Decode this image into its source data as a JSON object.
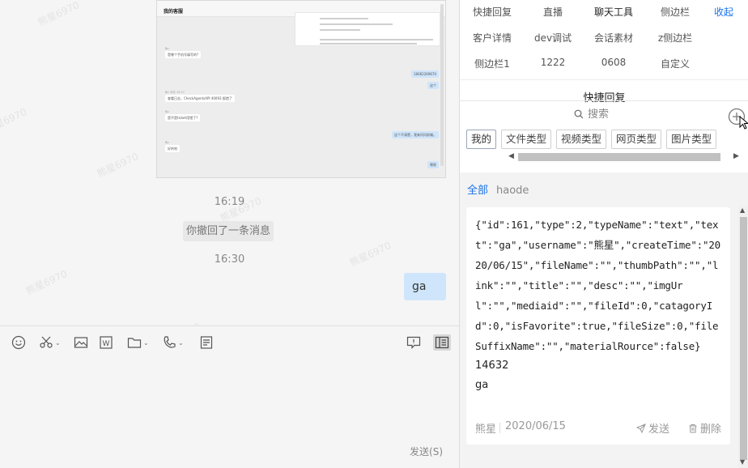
{
  "watermark": "熊星6970",
  "chat": {
    "screenshot": {
      "title": "我的客服",
      "messages": [
        {
          "name": "Bp",
          "text": "是哪个手机号填写的?",
          "me": false
        },
        {
          "name": "",
          "text": "18062269670",
          "me": true
        },
        {
          "name": "",
          "text": "这个",
          "me": true
        },
        {
          "name": "Bp  今天 15:17",
          "text": "查看日志，CheckAgentsAPI  40093 报错了",
          "me": false
        },
        {
          "name": "Bp",
          "text": "是不是ticket用错了?",
          "me": false
        },
        {
          "name": "",
          "text": "这个不清楚，我来问问前端。",
          "me": true
        },
        {
          "name": "Bp",
          "text": "好的哈",
          "me": false
        },
        {
          "name": "",
          "text": "嗯呢",
          "me": true
        }
      ]
    },
    "time1": "16:19",
    "recall_notice": "你撤回了一条消息",
    "time2": "16:30",
    "my_message": "ga",
    "send_label": "发送(S)"
  },
  "toolbar": {
    "icons": [
      "emoji-icon",
      "scissors-icon",
      "image-icon",
      "word-file-icon",
      "folder-icon",
      "phone-icon",
      "notes-icon",
      "feedback-icon",
      "sidebar-toggle-icon"
    ]
  },
  "sidebar": {
    "nav": [
      {
        "label": "快捷回复"
      },
      {
        "label": "直播"
      },
      {
        "label": "聊天工具"
      },
      {
        "label": "侧边栏"
      },
      {
        "label": "收起"
      },
      {
        "label": "客户详情"
      },
      {
        "label": "dev调试"
      },
      {
        "label": "会话素材"
      },
      {
        "label": "z侧边栏"
      },
      {
        "label": "侧边栏1"
      },
      {
        "label": "1222"
      },
      {
        "label": "0608"
      },
      {
        "label": "自定义"
      }
    ],
    "section_title": "快捷回复",
    "search_placeholder": "搜索",
    "categories": [
      "我的",
      "文件类型",
      "视频类型",
      "网页类型",
      "图片类型"
    ],
    "filters": {
      "all": "全部",
      "haode": "haode"
    },
    "card": {
      "json_text": "{\"id\":161,\"type\":2,\"typeName\":\"text\",\"text\":\"ga\",\"username\":\"熊星\",\"createTime\":\"2020/06/15\",\"fileName\":\"\",\"thumbPath\":\"\",\"link\":\"\",\"title\":\"\",\"desc\":\"\",\"imgUrl\":\"\",\"mediaid\":\"\",\"fileId\":0,\"catagoryId\":0,\"isFavorite\":true,\"fileSize\":0,\"fileSuffixName\":\"\",\"materialRource\":false}",
      "number": "14632",
      "text": "ga",
      "author": "熊星",
      "date": "2020/06/15",
      "send_label": "发送",
      "delete_label": "删除"
    }
  },
  "colors": {
    "accent": "#1a73e8",
    "my_bubble": "#cfe5fb"
  }
}
